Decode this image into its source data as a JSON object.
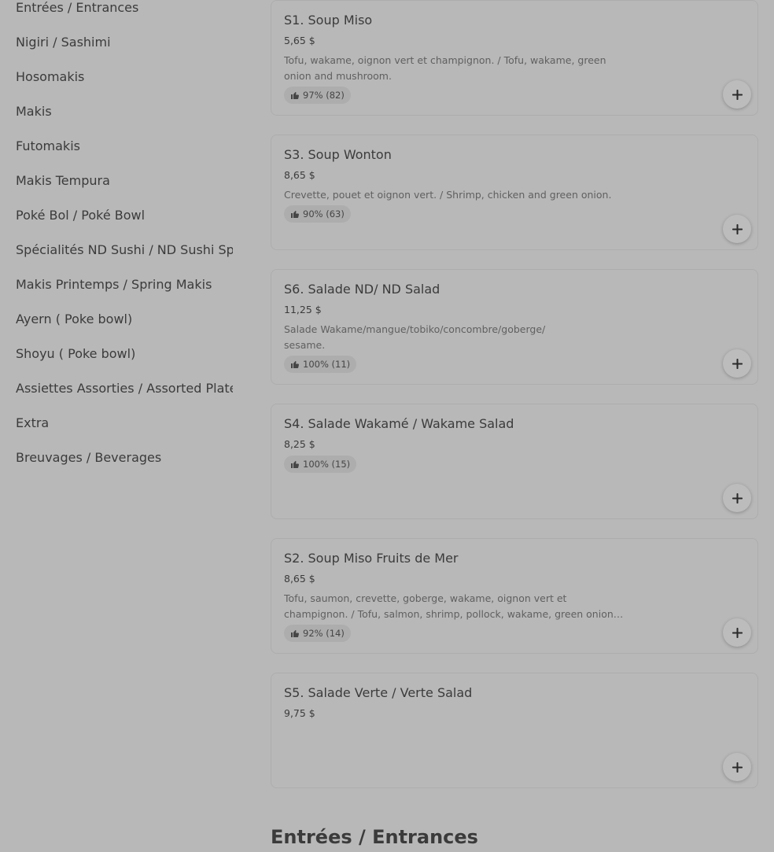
{
  "sidebar": {
    "items": [
      {
        "label": "Entrées / Entrances"
      },
      {
        "label": "Nigiri / Sashimi"
      },
      {
        "label": "Hosomakis"
      },
      {
        "label": "Makis"
      },
      {
        "label": "Futomakis"
      },
      {
        "label": "Makis Tempura"
      },
      {
        "label": "Poké Bol / Poké Bowl"
      },
      {
        "label": "Spécialités ND Sushi / ND Sushi Specialties"
      },
      {
        "label": "Makis Printemps / Spring Makis"
      },
      {
        "label": "Ayern ( Poke bowl)"
      },
      {
        "label": "Shoyu ( Poke bowl)"
      },
      {
        "label": "Assiettes Assorties / Assorted Plates"
      },
      {
        "label": "Extra"
      },
      {
        "label": "Breuvages / Beverages"
      }
    ]
  },
  "menu": {
    "items": [
      {
        "title": "S1. Soup Miso",
        "price": "5,65 $",
        "description": "Tofu, wakame, oignon vert et champignon. / Tofu, wakame, green onion and mushroom.",
        "rating": "97% (82)"
      },
      {
        "title": "S3. Soup Wonton",
        "price": "8,65 $",
        "description": "Crevette, pouet et oignon vert. / Shrimp, chicken and green onion.",
        "rating": "90% (63)"
      },
      {
        "title": "S6. Salade ND/ ND Salad",
        "price": "11,25 $",
        "description": "Salade Wakame/mangue/tobiko/concombre/goberge/ sesame.",
        "rating": "100% (11)"
      },
      {
        "title": "S4. Salade Wakamé / Wakame Salad",
        "price": "8,25 $",
        "description": "",
        "rating": "100% (15)"
      },
      {
        "title": "S2. Soup Miso Fruits de Mer",
        "price": "8,65 $",
        "description": "Tofu, saumon, crevette, goberge, wakame, oignon vert et champignon. / Tofu, salmon, shrimp, pollock, wakame, green onion and mushroom.",
        "rating": "92% (14)"
      },
      {
        "title": "S5. Salade Verte / Verte Salad",
        "price": "9,75 $",
        "description": "",
        "rating": ""
      }
    ]
  },
  "section": {
    "heading": "Entrées / Entrances"
  },
  "icons": {
    "rating": "thumbs-up-icon",
    "add": "plus-icon"
  },
  "colors": {
    "background": "#b8b8b8",
    "text": "#3b3b3b",
    "muted_text": "#606060",
    "card_border": "#adadad"
  }
}
